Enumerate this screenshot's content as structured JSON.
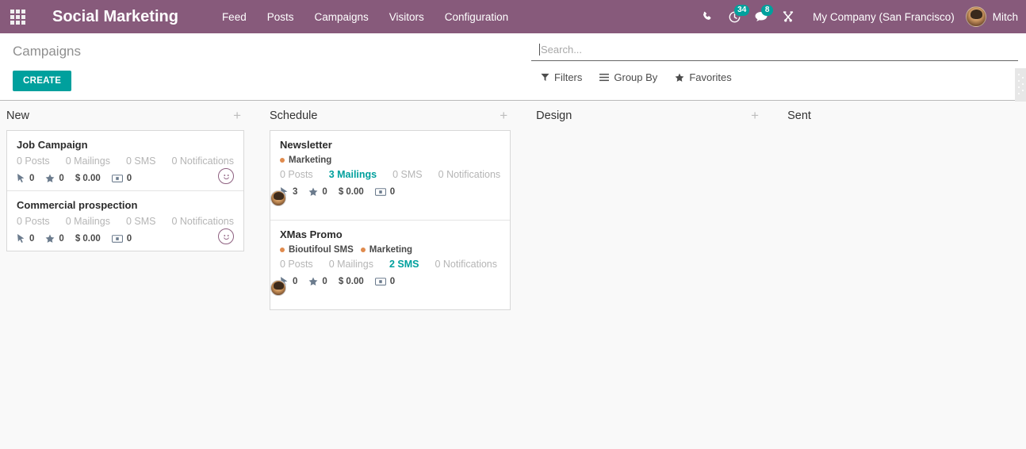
{
  "navbar": {
    "apps_icon": "apps-grid-icon",
    "brand": "Social Marketing",
    "menu": [
      {
        "label": "Feed"
      },
      {
        "label": "Posts"
      },
      {
        "label": "Campaigns"
      },
      {
        "label": "Visitors"
      },
      {
        "label": "Configuration"
      }
    ],
    "phone_icon": "phone-icon",
    "activities_icon": "clock-icon",
    "activities_count": "34",
    "messages_icon": "comment-icon",
    "messages_count": "8",
    "debug_icon": "wrench-icon",
    "company": "My Company (San Francisco)",
    "avatar_icon": "user-avatar",
    "user": "Mitch"
  },
  "control_panel": {
    "title": "Campaigns",
    "create_label": "CREATE",
    "search": {
      "value": "",
      "placeholder": "Search..."
    },
    "tools": [
      {
        "label": "Filters",
        "icon": "filter-icon"
      },
      {
        "label": "Group By",
        "icon": "list-icon"
      },
      {
        "label": "Favorites",
        "icon": "star-icon"
      }
    ]
  },
  "colors": {
    "brand_purple": "#875a7b",
    "accent_teal": "#00a09d",
    "tag_orange": "#e08b4e",
    "muted_gray": "#b5b5b5",
    "page_bg": "#f9f9f9"
  },
  "kanban": {
    "add_icon": "plus-icon",
    "columns": [
      {
        "title": "New",
        "cards": [
          {
            "title": "Job Campaign",
            "tags": [],
            "stats": [
              {
                "label": "0 Posts",
                "active": false
              },
              {
                "label": "0 Mailings",
                "active": false
              },
              {
                "label": "0 SMS",
                "active": false
              },
              {
                "label": "0 Notifications",
                "active": false
              }
            ],
            "metrics": [
              {
                "icon": "mouse-pointer-icon",
                "value": "0"
              },
              {
                "icon": "star-icon",
                "value": "0"
              },
              {
                "icon": "dollar-icon",
                "value": "$ 0.00"
              },
              {
                "icon": "money-bill-icon",
                "value": "0"
              }
            ],
            "avatar": "smiley-avatar"
          },
          {
            "title": "Commercial prospection",
            "tags": [],
            "stats": [
              {
                "label": "0 Posts",
                "active": false
              },
              {
                "label": "0 Mailings",
                "active": false
              },
              {
                "label": "0 SMS",
                "active": false
              },
              {
                "label": "0 Notifications",
                "active": false
              }
            ],
            "metrics": [
              {
                "icon": "mouse-pointer-icon",
                "value": "0"
              },
              {
                "icon": "star-icon",
                "value": "0"
              },
              {
                "icon": "dollar-icon",
                "value": "$ 0.00"
              },
              {
                "icon": "money-bill-icon",
                "value": "0"
              }
            ],
            "avatar": "smiley-avatar"
          }
        ]
      },
      {
        "title": "Schedule",
        "cards": [
          {
            "title": "Newsletter",
            "tags": [
              {
                "label": "Marketing",
                "color": "#e08b4e"
              }
            ],
            "stats": [
              {
                "label": "0 Posts",
                "active": false
              },
              {
                "label": "3 Mailings",
                "active": true
              },
              {
                "label": "0 SMS",
                "active": false
              },
              {
                "label": "0 Notifications",
                "active": false
              }
            ],
            "metrics": [
              {
                "icon": "mouse-pointer-icon",
                "value": "3"
              },
              {
                "icon": "star-icon",
                "value": "0"
              },
              {
                "icon": "dollar-icon",
                "value": "$ 0.00"
              },
              {
                "icon": "money-bill-icon",
                "value": "0"
              }
            ],
            "avatar": "photo-avatar"
          },
          {
            "title": "XMas Promo",
            "tags": [
              {
                "label": "Bioutifoul SMS",
                "color": "#e08b4e"
              },
              {
                "label": "Marketing",
                "color": "#e08b4e"
              }
            ],
            "stats": [
              {
                "label": "0 Posts",
                "active": false
              },
              {
                "label": "0 Mailings",
                "active": false
              },
              {
                "label": "2 SMS",
                "active": true
              },
              {
                "label": "0 Notifications",
                "active": false
              }
            ],
            "metrics": [
              {
                "icon": "mouse-pointer-icon",
                "value": "0"
              },
              {
                "icon": "star-icon",
                "value": "0"
              },
              {
                "icon": "dollar-icon",
                "value": "$ 0.00"
              },
              {
                "icon": "money-bill-icon",
                "value": "0"
              }
            ],
            "avatar": "photo-avatar"
          }
        ]
      },
      {
        "title": "Design",
        "cards": []
      },
      {
        "title": "Sent",
        "cards": []
      }
    ]
  }
}
